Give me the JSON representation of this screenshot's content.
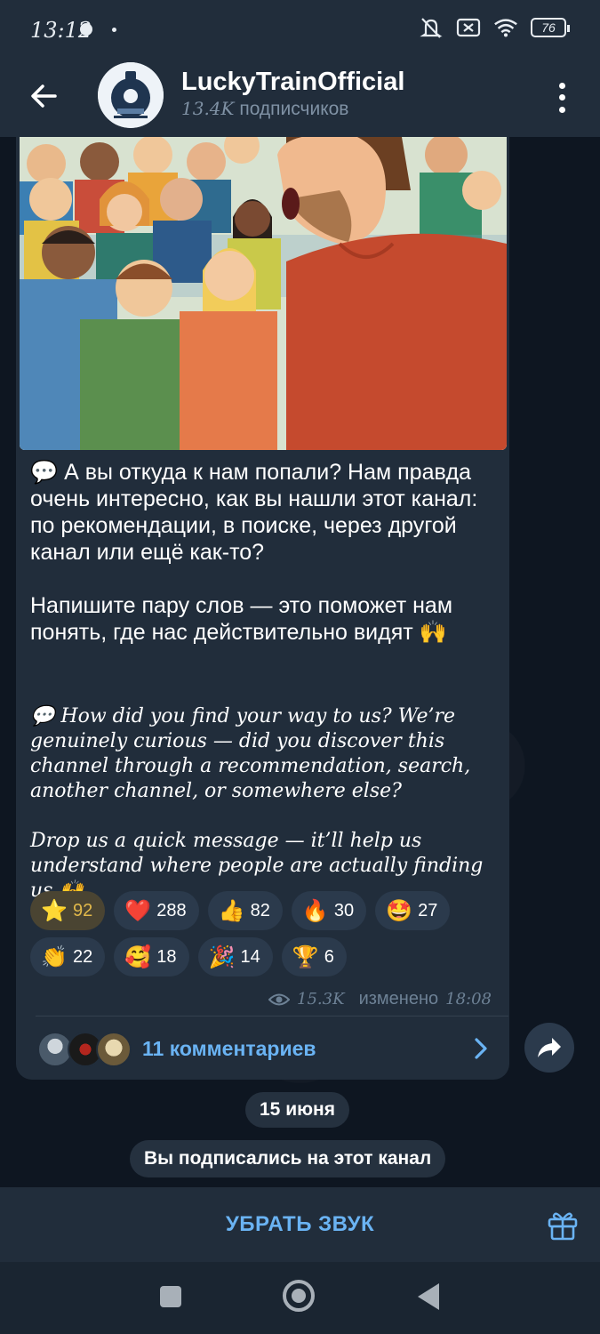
{
  "status_bar": {
    "time": "13:12",
    "battery": "76"
  },
  "header": {
    "channel_name": "LuckyTrainOfficial",
    "subscribers_count": "13.4K",
    "subscribers_label": "подписчиков"
  },
  "post": {
    "ru_paragraphs": [
      "А вы откуда к нам попали? Нам правда очень интересно, как вы нашли этот канал: по рекомендации, в поиске, через другой канал или ещё как-то?",
      "Напишите пару слов — это поможет нам понять, где нас действительно видят"
    ],
    "en_paragraphs": [
      "How did you find your way to us? We’re genuinely curious — did you discover this channel through a recommendation, search, another channel, or somewhere else?",
      "Drop us a quick message — it’ll help us understand where people are actually finding us"
    ],
    "emoji_speech": "💬",
    "emoji_hands": "🙌",
    "reactions": [
      {
        "emoji": "⭐",
        "count": "92",
        "active": true
      },
      {
        "emoji": "❤️",
        "count": "288"
      },
      {
        "emoji": "👍",
        "count": "82"
      },
      {
        "emoji": "🔥",
        "count": "30"
      },
      {
        "emoji": "🤩",
        "count": "27"
      },
      {
        "emoji": "👏",
        "count": "22"
      },
      {
        "emoji": "🥰",
        "count": "18"
      },
      {
        "emoji": "🎉",
        "count": "14"
      },
      {
        "emoji": "🏆",
        "count": "6"
      }
    ],
    "views": "15.3K",
    "edited_label": "изменено",
    "edited_time": "18:08",
    "comments_label": "11 комментариев"
  },
  "date_separator": "15 июня",
  "service_message": "Вы подписались на этот канал",
  "bottom": {
    "mute_label": "УБРАТЬ ЗВУК"
  },
  "colors": {
    "accent": "#6ab3f3",
    "bubble": "#212d3b",
    "background": "#0e1621"
  }
}
